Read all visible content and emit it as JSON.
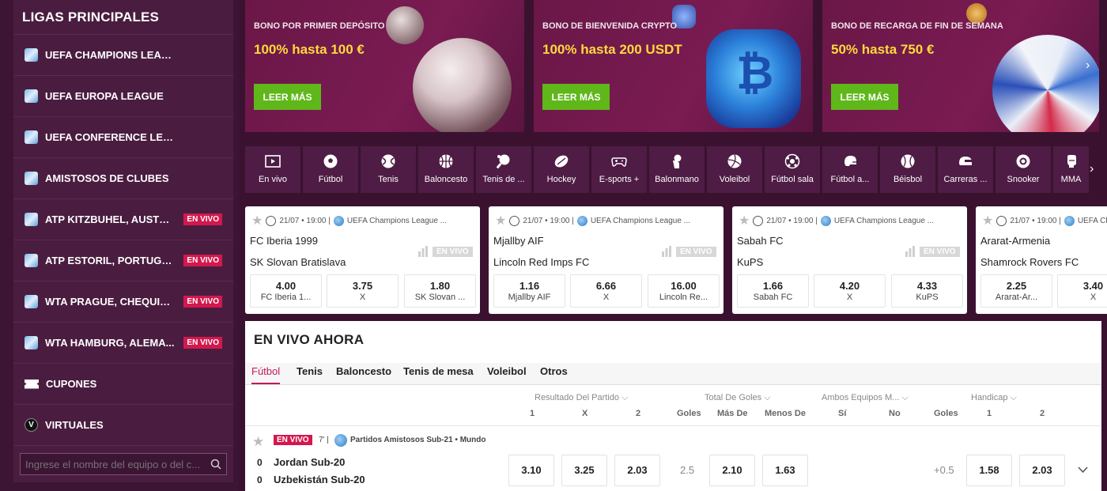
{
  "sidebar": {
    "title": "LIGAS PRINCIPALES",
    "items": [
      {
        "label": "UEFA CHAMPIONS LEAGUE",
        "live": ""
      },
      {
        "label": "UEFA EUROPA LEAGUE",
        "live": ""
      },
      {
        "label": "UEFA CONFERENCE LEAGUE",
        "live": ""
      },
      {
        "label": "AMISTOSOS DE CLUBES",
        "live": ""
      },
      {
        "label": "ATP KITZBUHEL, AUSTRI...",
        "live": "EN VIVO"
      },
      {
        "label": "ATP ESTORIL, PORTUGAL...",
        "live": "EN VIVO"
      },
      {
        "label": "WTA PRAGUE, CHEQUIA, ...",
        "live": "EN VIVO"
      },
      {
        "label": "WTA HAMBURG, ALEMA...",
        "live": "EN VIVO"
      }
    ],
    "coupons": "CUPONES",
    "virtuals": "VIRTUALES",
    "virtuals_icon_letter": "V",
    "search_placeholder": "Ingrese el nombre del equipo o del c..."
  },
  "banners": [
    {
      "title": "BONO POR PRIMER DEPÓSITO",
      "amount": "100% hasta 100 €",
      "button": "LEER MÁS"
    },
    {
      "title": "BONO DE BIENVENIDA CRYPTO",
      "amount": "100% hasta 200 USDT",
      "button": "LEER MÁS"
    },
    {
      "title": "BONO DE RECARGA DE FIN DE SEMANA",
      "amount": "50% hasta 750 €",
      "button": "LEER MÁS"
    }
  ],
  "sports": [
    {
      "label": "En vivo",
      "icon": "play-icon"
    },
    {
      "label": "Fútbol",
      "icon": "soccer-ball-icon"
    },
    {
      "label": "Tenis",
      "icon": "tennis-ball-icon"
    },
    {
      "label": "Baloncesto",
      "icon": "basketball-icon"
    },
    {
      "label": "Tenis de ...",
      "icon": "table-tennis-icon"
    },
    {
      "label": "Hockey",
      "icon": "hockey-puck-icon"
    },
    {
      "label": "E-sports +",
      "icon": "gamepad-icon"
    },
    {
      "label": "Balonmano",
      "icon": "handball-icon"
    },
    {
      "label": "Voleibol",
      "icon": "volleyball-icon"
    },
    {
      "label": "Fútbol sala",
      "icon": "futsal-ball-icon"
    },
    {
      "label": "Fútbol a...",
      "icon": "football-helmet-icon"
    },
    {
      "label": "Béisbol",
      "icon": "baseball-icon"
    },
    {
      "label": "Carreras ...",
      "icon": "racing-helmet-icon"
    },
    {
      "label": "Snooker",
      "icon": "snooker-ball-icon"
    },
    {
      "label": "MMA",
      "icon": "mma-glove-icon"
    }
  ],
  "live_cards": [
    {
      "time": "21/07 • 19:00 |",
      "league": "UEFA Champions League ...",
      "team1": "FC Iberia 1999",
      "team2": "SK Slovan Bratislava",
      "live": "EN VIVO",
      "odds": [
        {
          "v": "4.00",
          "l": "FC Iberia 1..."
        },
        {
          "v": "3.75",
          "l": "X"
        },
        {
          "v": "1.80",
          "l": "SK Slovan ..."
        }
      ]
    },
    {
      "time": "21/07 • 19:00 |",
      "league": "UEFA Champions League ...",
      "team1": "Mjallby AIF",
      "team2": "Lincoln Red Imps FC",
      "live": "EN VIVO",
      "odds": [
        {
          "v": "1.16",
          "l": "Mjallby AIF"
        },
        {
          "v": "6.66",
          "l": "X"
        },
        {
          "v": "16.00",
          "l": "Lincoln Re..."
        }
      ]
    },
    {
      "time": "21/07 • 19:00 |",
      "league": "UEFA Champions League ...",
      "team1": "Sabah FC",
      "team2": "KuPS",
      "live": "EN VIVO",
      "odds": [
        {
          "v": "1.66",
          "l": "Sabah FC"
        },
        {
          "v": "4.20",
          "l": "X"
        },
        {
          "v": "4.33",
          "l": "KuPS"
        }
      ]
    },
    {
      "time": "21/07 • 19:00 |",
      "league": "UEFA Champions League ...",
      "team1": "Ararat-Armenia",
      "team2": "Shamrock Rovers FC",
      "live": "",
      "odds": [
        {
          "v": "2.25",
          "l": "Ararat-Ar..."
        },
        {
          "v": "3.40",
          "l": "X"
        },
        {
          "v": "",
          "l": ""
        }
      ]
    }
  ],
  "live_now": {
    "title": "EN VIVO AHORA",
    "tabs": [
      "Fútbol",
      "Tenis",
      "Baloncesto",
      "Tenis de mesa",
      "Voleibol",
      "Otros"
    ],
    "groups": [
      "Resultado Del Partido",
      "Total De Goles",
      "Ambos Equipos M...",
      "Handicap"
    ],
    "subs": [
      "1",
      "X",
      "2",
      "Goles",
      "Más De",
      "Menos De",
      "Sí",
      "No",
      "Goles",
      "1",
      "2"
    ],
    "event": {
      "badge": "EN VIVO",
      "minute": "7' |",
      "league": "Partidos Amistosos Sub-21 • Mundo",
      "score1": "0",
      "team1": "Jordan Sub-20",
      "score2": "0",
      "team2": "Uzbekistán Sub-20",
      "odds_1x2": [
        "3.10",
        "3.25",
        "2.03"
      ],
      "goals_line": "2.5",
      "over": "2.10",
      "under": "1.63",
      "handicap_line": "+0.5",
      "handicap": [
        "1.58",
        "2.03"
      ]
    }
  },
  "colors": {
    "accent": "#c2185b",
    "live": "#d3184e",
    "cta": "#5fb71a",
    "bonus": "#ffd93a"
  }
}
